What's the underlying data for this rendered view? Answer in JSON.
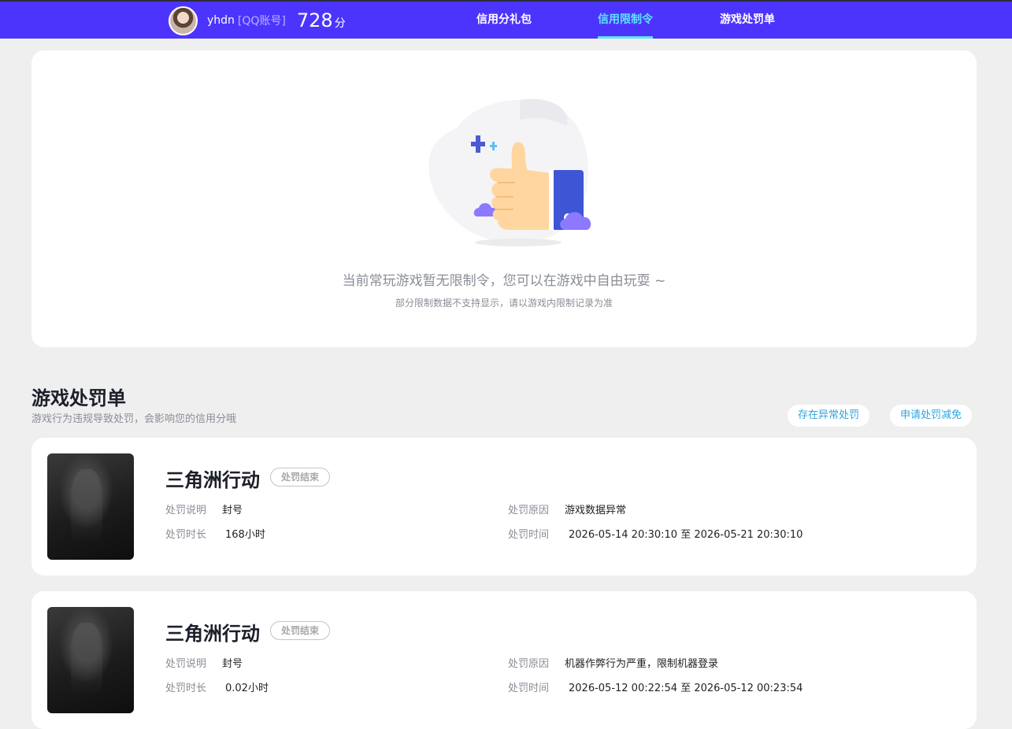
{
  "header": {
    "username": "yhdn",
    "account_type": "[QQ账号]",
    "score": "728",
    "score_unit": "分",
    "tabs": [
      {
        "label": "信用分礼包",
        "active": false
      },
      {
        "label": "信用限制令",
        "active": true
      },
      {
        "label": "游戏处罚单",
        "active": false
      }
    ],
    "brand_color": "#4d34fd",
    "active_color": "#5fe3ff"
  },
  "empty_state": {
    "title": "当前常玩游戏暂无限制令，您可以在游戏中自由玩耍 ~",
    "subtitle": "部分限制数据不支持显示，请以游戏内限制记录为准",
    "illustration_icon": "thumbs-up-icon"
  },
  "penalties": {
    "title": "游戏处罚单",
    "subtitle": "游戏行为违规导致处罚，会影响您的信用分哦",
    "buttons": {
      "abnormal": "存在异常处罚",
      "appeal": "申请处罚减免"
    },
    "labels": {
      "description": "处罚说明",
      "duration": "处罚时长",
      "reason": "处罚原因",
      "time": "处罚时间"
    },
    "items": [
      {
        "game": "三角洲行动",
        "status": "处罚结束",
        "description": "封号",
        "duration": "168小时",
        "reason": "游戏数据异常",
        "time": "2026-05-14 20:30:10 至 2026-05-21 20:30:10"
      },
      {
        "game": "三角洲行动",
        "status": "处罚结束",
        "description": "封号",
        "duration": "0.02小时",
        "reason": "机器作弊行为严重，限制机器登录",
        "time": "2026-05-12 00:22:54 至 2026-05-12 00:23:54"
      }
    ]
  }
}
